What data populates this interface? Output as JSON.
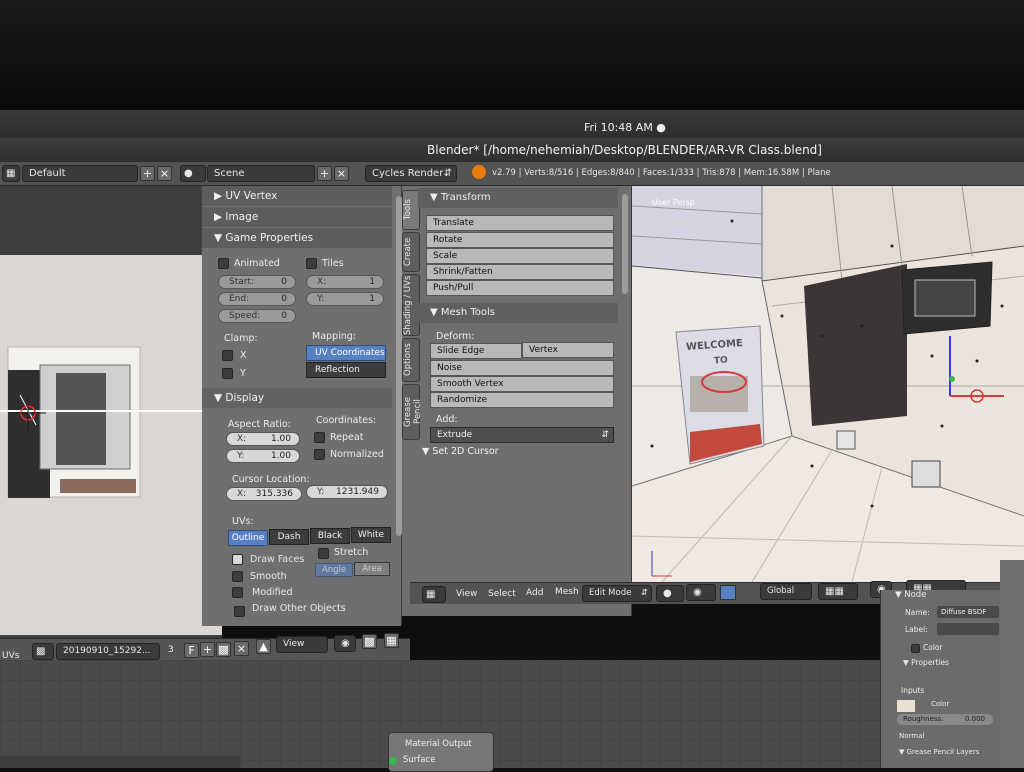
{
  "os": {
    "clock": "Fri 10:48 AM ●"
  },
  "window": {
    "title": "Blender* [/home/nehemiah/Desktop/BLENDER/AR-VR Class.blend]"
  },
  "info_header": {
    "layout": "Default",
    "scene": "Scene",
    "engine": "Cycles Render",
    "stats": "v2.79 | Verts:8/516 | Edges:8/840 | Faces:1/333 | Tris:878 | Mem:16.58M | Plane"
  },
  "properties": {
    "uv_vertex": "UV Vertex",
    "image": "Image",
    "game_properties": "Game Properties",
    "animated": "Animated",
    "tiles": "Tiles",
    "start_label": "Start:",
    "start_value": "0",
    "end_label": "End:",
    "end_value": "0",
    "speed_label": "Speed:",
    "speed_value": "0",
    "tile_x_label": "X:",
    "tile_x_value": "1",
    "tile_y_label": "Y:",
    "tile_y_value": "1",
    "clamp": "Clamp:",
    "mapping": "Mapping:",
    "clamp_x": "X",
    "clamp_y": "Y",
    "uv_coordinates": "UV Coordinates",
    "reflection": "Reflection",
    "display": "Display",
    "aspect_ratio": "Aspect Ratio:",
    "coordinates": "Coordinates:",
    "aspect_x_label": "X:",
    "aspect_x_value": "1.00",
    "aspect_y_label": "Y:",
    "aspect_y_value": "1.00",
    "repeat": "Repeat",
    "normalized": "Normalized",
    "cursor_location": "Cursor Location:",
    "cursor_x_label": "X:",
    "cursor_x_value": "315.336",
    "cursor_y_label": "Y:",
    "cursor_y_value": "1231.949",
    "uvs": "UVs:",
    "uv_draw_modes": [
      "Outline",
      "Dash",
      "Black",
      "White"
    ],
    "draw_faces": "Draw Faces",
    "stretch": "Stretch",
    "angle": "Angle",
    "area": "Area",
    "smooth": "Smooth",
    "modified": "Modified",
    "draw_other_objects": "Draw Other Objects"
  },
  "toolshelf": {
    "tabs": [
      "Tools",
      "Create",
      "Shading / UVs",
      "Options",
      "Grease Pencil"
    ],
    "transform": "Transform",
    "transform_buttons": [
      "Translate",
      "Rotate",
      "Scale",
      "Shrink/Fatten",
      "Push/Pull"
    ],
    "mesh_tools": "Mesh Tools",
    "deform": "Deform:",
    "slide_edge": "Slide Edge",
    "vertex": "Vertex",
    "deform_buttons": [
      "Noise",
      "Smooth Vertex",
      "Randomize"
    ],
    "add": "Add:",
    "extrude": "Extrude",
    "set_2d_cursor": "Set 2D Cursor"
  },
  "viewport": {
    "view_label": "User Persp",
    "poster_line1": "WELCOME",
    "poster_line2": "TO",
    "menu": [
      "View",
      "Select",
      "Add",
      "Mesh"
    ],
    "mode": "Edit Mode",
    "orientation": "Global"
  },
  "image_header": {
    "editor": "UVs",
    "image_name": "20190910_15292...",
    "users": "3",
    "view": "View"
  },
  "node_editor": {
    "node_title": "Material Output",
    "socket": "Surface"
  },
  "node_panel": {
    "node": "Node",
    "name_label": "Name:",
    "name_value": "Diffuse BSDF",
    "label_label": "Label:",
    "color": "Color",
    "properties": "Properties",
    "inputs": "Inputs",
    "color_input": "Color",
    "roughness": "Roughness:",
    "roughness_value": "0.000",
    "normal": "Normal",
    "grease_pencil_layers": "Grease Pencil Layers"
  }
}
